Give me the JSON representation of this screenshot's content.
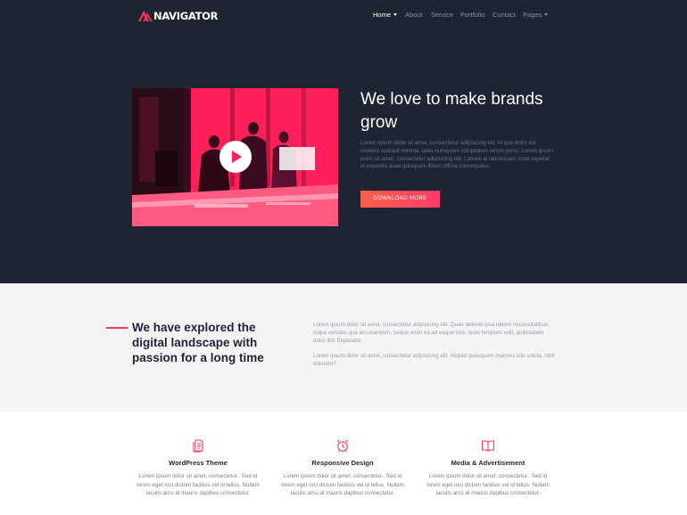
{
  "brand": {
    "name": "NAVIGATOR"
  },
  "nav": {
    "items": [
      {
        "label": "Home",
        "active": true,
        "dropdown": true
      },
      {
        "label": "About",
        "active": false,
        "dropdown": false
      },
      {
        "label": "Service",
        "active": false,
        "dropdown": false
      },
      {
        "label": "Portfolio",
        "active": false,
        "dropdown": false
      },
      {
        "label": "Contact",
        "active": false,
        "dropdown": false
      },
      {
        "label": "Pages",
        "active": false,
        "dropdown": true
      }
    ]
  },
  "hero": {
    "title": "We love to make brands grow",
    "text": "Lorem ipsum dolor sit amet, consectetur adipisicing elit. At quo dolor est incidunt suscipit minima, alias numquam voluptatum rerum porro. Lorem ipsum dolor sit amet, consectetur adipisicing elit. Labore at laboriosam unde repellat id expedita quae quisquam libero officia consequatur.",
    "button_label": "DOWNLOAD MORE",
    "video_icon": "play-icon"
  },
  "about": {
    "heading": "We have explored the digital landscape with passion for a long time",
    "paragraph_1": "Lorem ipsum dolor sit amet, consectetur adipisicing elit. Quae deleniti ipsa labore necessitatibus culpa veritatis qua accusantium, neque enim ea ad eaque iure, quas tempore velit, quibusdam dolor illo! Explicabo.",
    "paragraph_2": "Lorem ipsum dolor sit amet, consectetur adipisicing elit. Aliquid quasquam maiores iste soluta, nihil dolorem?"
  },
  "features": [
    {
      "icon": "document-icon",
      "title": "WordPress Theme",
      "text": "Lorem ipsum dolor sit amet, consectetur.. Sed id lorem eget orci dictum facilisis vel id tellus. Nullam iaculis arcu at mauris dapibus consectetur."
    },
    {
      "icon": "alarm-clock-icon",
      "title": "Responsive Design",
      "text": "Lorem ipsum dolor sit amet, consectetur.. Sed id lorem eget orci dictum facilisis vel id tellus. Nullam iaculis arcu at mauris dapibus consectetur."
    },
    {
      "icon": "open-book-icon",
      "title": "Media & Advertisement",
      "text": "Lorem ipsum dolor sit amet, consectetur.. Sed id lorem eget orci dictum facilisis vel id tellus. Nullam iaculis arcu at mauris dapibus consectetur."
    }
  ],
  "colors": {
    "dark_background": "#1f2433",
    "accent": "#f5385a",
    "button_gradient_start": "#f7604a",
    "button_gradient_end": "#ff3c6a",
    "light_section": "#f4f4f5"
  }
}
